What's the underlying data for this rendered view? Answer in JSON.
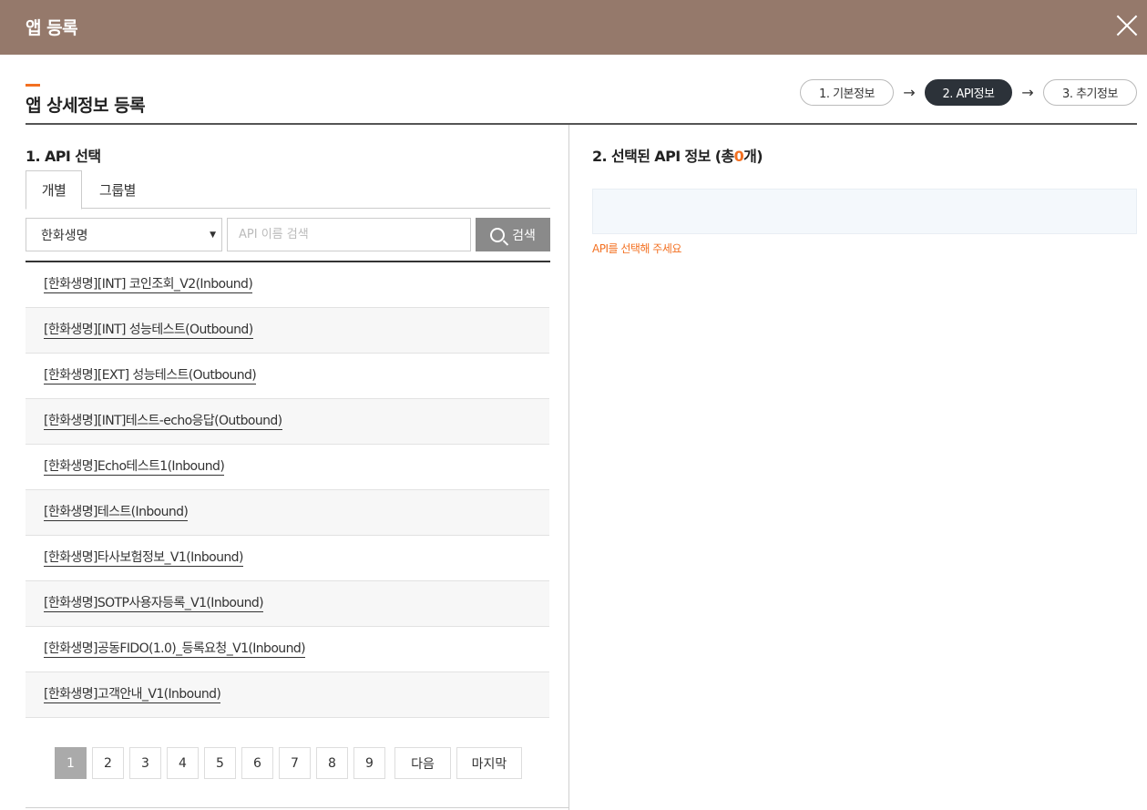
{
  "window": {
    "title": "앱 등록"
  },
  "page": {
    "title": "앱 상세정보 등록"
  },
  "steps": [
    {
      "label": "1. 기본정보",
      "active": false
    },
    {
      "label": "2. API정보",
      "active": true
    },
    {
      "label": "3. 추기정보",
      "active": false
    }
  ],
  "step_arrow": "→",
  "left": {
    "title": "1. API 선택",
    "tabs": [
      {
        "label": "개별",
        "active": true
      },
      {
        "label": "그룹별",
        "active": false
      }
    ],
    "select": {
      "value": "한화생명"
    },
    "search": {
      "placeholder": "API 이름 검색",
      "button_label": "검색"
    },
    "items": [
      "[한화생명][INT] 코인조회_V2(Inbound)",
      "[한화생명][INT] 성능테스트(Outbound)",
      "[한화생명][EXT] 성능테스트(Outbound)",
      "[한화생명][INT]테스트-echo응답(Outbound)",
      "[한화생명]Echo테스트1(Inbound)",
      "[한화생명]테스트(Inbound)",
      "[한화생명]타사보험정보_V1(Inbound)",
      "[한화생명]SOTP사용자등록_V1(Inbound)",
      "[한화생명]공동FIDO(1.0)_등록요청_V1(Inbound)",
      "[한화생명]고객안내_V1(Inbound)"
    ],
    "pagination": {
      "pages": [
        "1",
        "2",
        "3",
        "4",
        "5",
        "6",
        "7",
        "8",
        "9"
      ],
      "current": "1",
      "next_label": "다음",
      "last_label": "마지막"
    }
  },
  "right": {
    "title_prefix": "2. 선택된 API 정보 (총",
    "count": "0",
    "title_suffix": "개)",
    "empty_message": "API를 선택해 주세요"
  },
  "colors": {
    "header_bg": "#95796b",
    "accent": "#f37021",
    "active_step_bg": "#2c3239",
    "search_button_bg": "#8a8a8a"
  },
  "icons": {
    "close": "close-icon",
    "search": "search-icon",
    "dropdown": "chevron-down-icon"
  }
}
